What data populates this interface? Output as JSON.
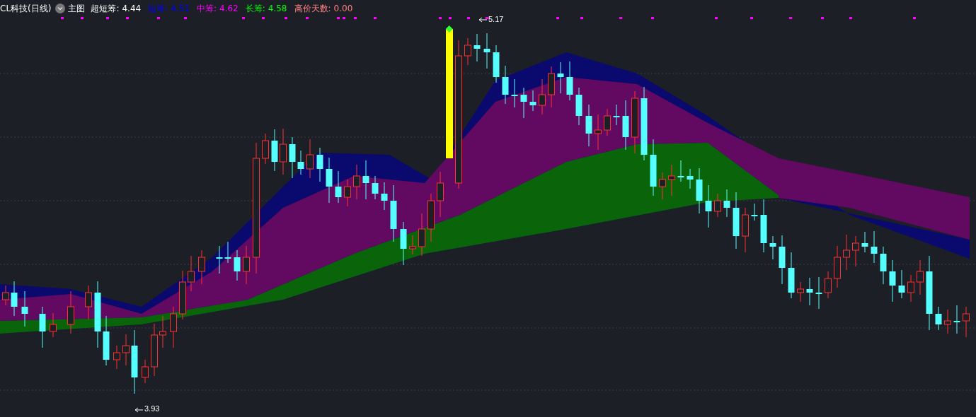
{
  "header": {
    "title": "CL科技(日线)",
    "main_label": "主图",
    "indicators": [
      {
        "label": "超短筹:",
        "value": "4.44",
        "color": "#ffffff"
      },
      {
        "label": "短筹:",
        "value": "4.51",
        "color": "#0000ff"
      },
      {
        "label": "中筹:",
        "value": "4.62",
        "color": "#ff00ff"
      },
      {
        "label": "长筹:",
        "value": "4.58",
        "color": "#00ff00"
      },
      {
        "label": "高价天数:",
        "value": "0.00",
        "color": "#ff8080"
      }
    ]
  },
  "chart": {
    "annotations": [
      {
        "text": "5.17"
      },
      {
        "text": "3.93"
      }
    ]
  }
}
